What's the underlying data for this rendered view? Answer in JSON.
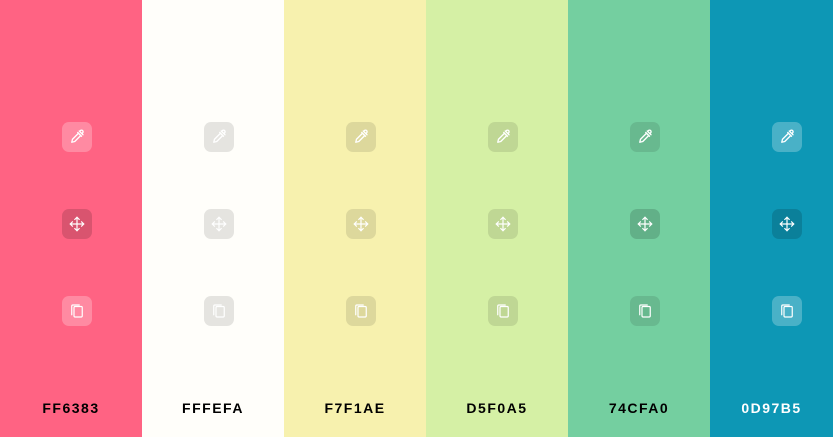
{
  "swatches": [
    {
      "hex": "FF6383",
      "color": "#FF6383"
    },
    {
      "hex": "FFFEFA",
      "color": "#FFFEFA"
    },
    {
      "hex": "F7F1AE",
      "color": "#F7F1AE"
    },
    {
      "hex": "D5F0A5",
      "color": "#D5F0A5"
    },
    {
      "hex": "74CFA0",
      "color": "#74CFA0"
    },
    {
      "hex": "0D97B5",
      "color": "#0D97B5"
    }
  ],
  "icons": {
    "picker": "eyedropper-icon",
    "move": "move-arrows-icon",
    "copy": "copy-icon"
  }
}
